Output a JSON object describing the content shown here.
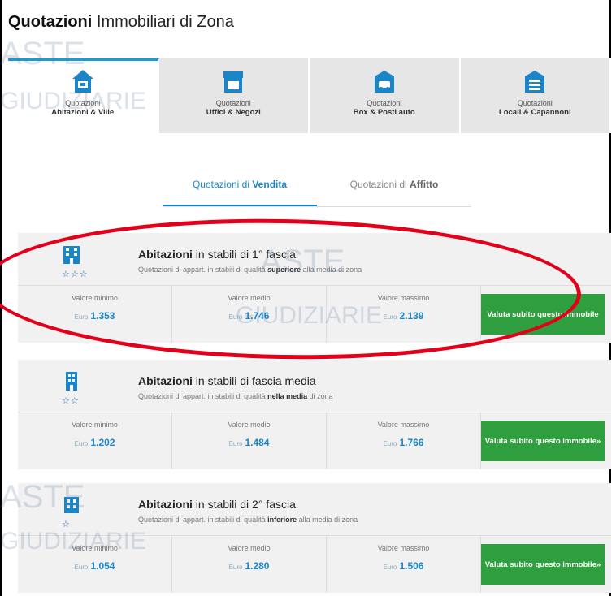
{
  "title": {
    "bold": "Quotazioni",
    "rest": " Immobiliari di Zona"
  },
  "tabs": [
    {
      "small": "Quotazioni",
      "big": "Abitazioni & Ville"
    },
    {
      "small": "Quotazioni",
      "big": "Uffici & Negozi"
    },
    {
      "small": "Quotazioni",
      "big": "Box & Posti auto"
    },
    {
      "small": "Quotazioni",
      "big": "Locali & Capannoni"
    }
  ],
  "sub_tabs": [
    {
      "pre": "Quotazioni di ",
      "bold": "Vendita"
    },
    {
      "pre": "Quotazioni di ",
      "bold": "Affitto"
    }
  ],
  "cards": [
    {
      "title_bold": "Abitazioni",
      "title_rest": " in stabili di 1° fascia",
      "sub_pre": "Quotazioni di appart. in stabili di qualità ",
      "sub_bold": "superiore",
      "sub_post": " alla media di zona",
      "stars": "☆☆☆",
      "min_label": "Valore minimo",
      "min_cur": "Euro",
      "min_val": "1.353",
      "mid_label": "Valore medio",
      "mid_cur": "Euro",
      "mid_val": "1.746",
      "max_label": "Valore massimo",
      "max_cur": "Euro",
      "max_val": "2.139",
      "btn": "Valuta subito questo immobile"
    },
    {
      "title_bold": "Abitazioni",
      "title_rest": " in stabili di fascia media",
      "sub_pre": "Quotazioni di appart. in stabili di qualità ",
      "sub_bold": "nella media",
      "sub_post": " di zona",
      "stars": "☆☆",
      "min_label": "Valore minimo",
      "min_cur": "Euro",
      "min_val": "1.202",
      "mid_label": "Valore medio",
      "mid_cur": "Euro",
      "mid_val": "1.484",
      "max_label": "Valore massimo",
      "max_cur": "Euro",
      "max_val": "1.766",
      "btn": "Valuta subito questo immobile»"
    },
    {
      "title_bold": "Abitazioni",
      "title_rest": " in stabili di 2° fascia",
      "sub_pre": "Quotazioni di appart. in stabili di qualità ",
      "sub_bold": "inferiore",
      "sub_post": " alla media di zona",
      "stars": "☆",
      "min_label": "Valore minimo",
      "min_cur": "Euro",
      "min_val": "1.054",
      "mid_label": "Valore medio",
      "mid_cur": "Euro",
      "mid_val": "1.280",
      "max_label": "Valore massimo",
      "max_cur": "Euro",
      "max_val": "1.506",
      "btn": "Valuta subito questo immobile»"
    }
  ],
  "watermark": {
    "line1": "ASTE",
    "line2": "GIUDIZIARIE"
  },
  "colors": {
    "accent": "#1a86c9",
    "button": "#2e9e3e",
    "highlight": "#e3001b"
  }
}
